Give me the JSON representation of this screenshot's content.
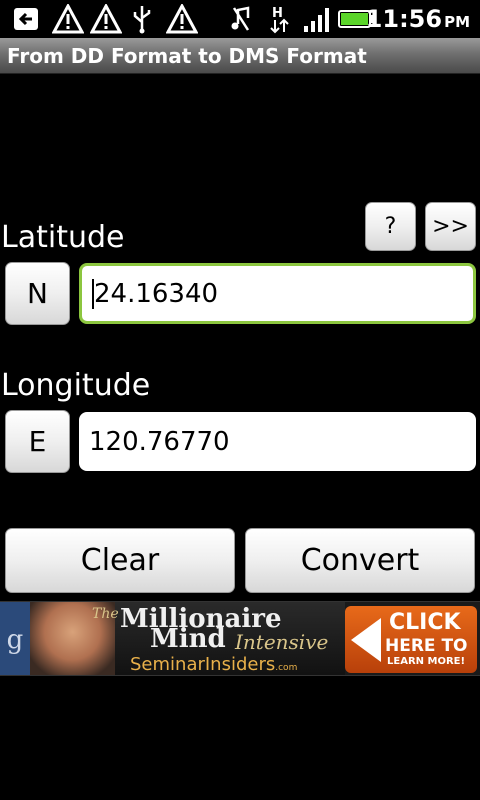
{
  "status_bar": {
    "time": "11:56",
    "ampm": "PM",
    "icons": [
      "back-arrow-icon",
      "warning-icon",
      "warning-icon",
      "usb-icon",
      "warning-icon",
      "mute-icon",
      "h-data-icon",
      "signal-icon",
      "battery-icon"
    ]
  },
  "title": "From DD Format to DMS Format",
  "help_button": "?",
  "next_button": ">>",
  "latitude": {
    "label": "Latitude",
    "hemisphere": "N",
    "value": "24.16340"
  },
  "longitude": {
    "label": "Longitude",
    "hemisphere": "E",
    "value": "120.76770"
  },
  "clear_button": "Clear",
  "convert_button": "Convert",
  "ad": {
    "badge": "g",
    "the": "The",
    "line1": "Millionaire",
    "line2": "Mind",
    "line3": "Intensive",
    "sponsor": "SeminarInsiders",
    "sponsor_suffix": ".com",
    "cta1": "CLICK",
    "cta2": "HERE TO",
    "cta3": "LEARN MORE!"
  },
  "colors": {
    "focus_border": "#8cc63f",
    "battery": "#5bd52a",
    "ad_cta": "#e86a1a"
  }
}
